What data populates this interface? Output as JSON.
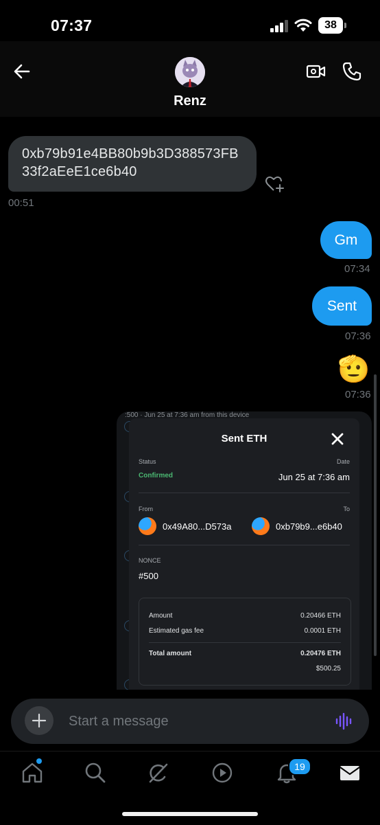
{
  "status_bar": {
    "time": "07:37",
    "battery": "38"
  },
  "header": {
    "contact_name": "Renz"
  },
  "messages": {
    "address_text": "0xb79b91e4BB80b9b3D388573FB33f2aEeE1ce6b40",
    "address_time": "00:51",
    "gm_text": "Gm",
    "gm_time": "07:34",
    "sent_text": "Sent",
    "sent_time": "07:36",
    "emoji_text": "🫡",
    "emoji_time": "07:36"
  },
  "screenshot": {
    "behind_text": ":500 · Jun 25 at 7:36 am from this device",
    "title": "Sent ETH",
    "status_label": "Status",
    "status_value": "Confirmed",
    "date_label": "Date",
    "date_value": "Jun 25 at 7:36 am",
    "from_label": "From",
    "to_label": "To",
    "from_address": "0x49A80...D573a",
    "to_address": "0xb79b9...e6b40",
    "nonce_label": "NONCE",
    "nonce_value": "#500",
    "amount_label": "Amount",
    "amount_value": "0.20466 ETH",
    "gas_label": "Estimated gas fee",
    "gas_value": "0.0001 ETH",
    "total_label": "Total amount",
    "total_value": "0.20476 ETH",
    "total_usd": "$500.25"
  },
  "composer": {
    "placeholder": "Start a message"
  },
  "nav": {
    "notification_count": "19"
  },
  "colors": {
    "accent": "#1d9bf0",
    "confirmed": "#4bb872",
    "voice": "#7856ff"
  }
}
